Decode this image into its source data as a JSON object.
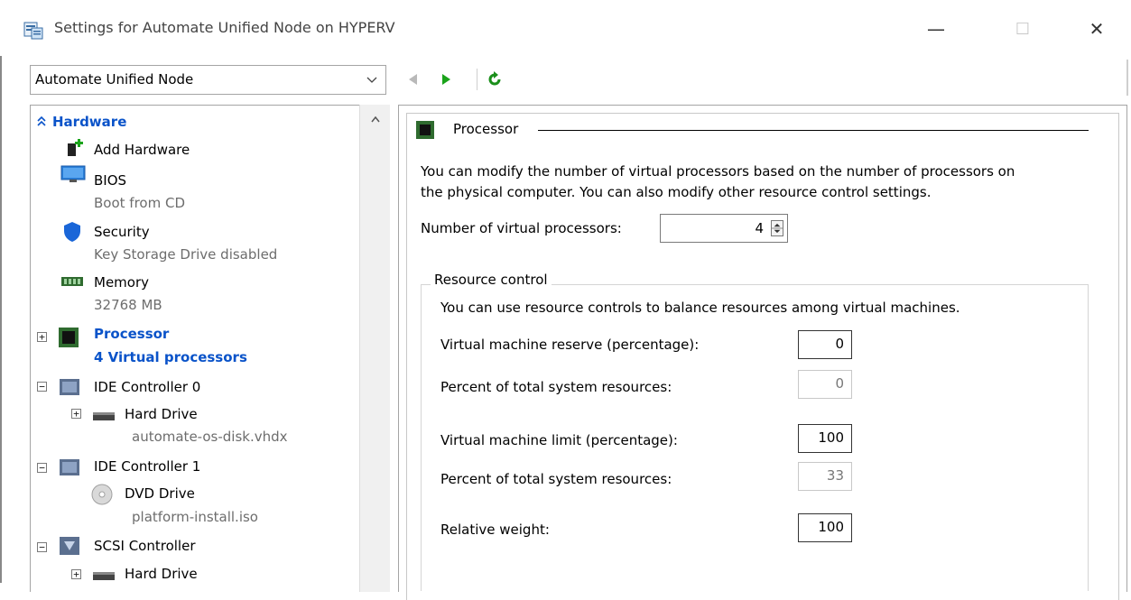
{
  "window": {
    "title": "Settings for Automate Unified Node on HYPERV",
    "minimize_glyph": "—",
    "maximize_glyph": "☐",
    "close_glyph": "✕"
  },
  "vm_select": {
    "value": "Automate Unified Node"
  },
  "tree": {
    "hardware_header": "Hardware",
    "items": [
      {
        "label": "Add Hardware",
        "sub": ""
      },
      {
        "label": "BIOS",
        "sub": "Boot from CD"
      },
      {
        "label": "Security",
        "sub": "Key Storage Drive disabled"
      },
      {
        "label": "Memory",
        "sub": "32768 MB"
      },
      {
        "label": "Processor",
        "sub": "4 Virtual processors"
      },
      {
        "label": "IDE Controller 0",
        "sub": ""
      },
      {
        "label": "Hard Drive",
        "sub": "automate-os-disk.vhdx"
      },
      {
        "label": "IDE Controller 1",
        "sub": ""
      },
      {
        "label": "DVD Drive",
        "sub": "platform-install.iso"
      },
      {
        "label": "SCSI Controller",
        "sub": ""
      },
      {
        "label": "Hard Drive",
        "sub": ""
      }
    ]
  },
  "processor": {
    "section_title": "Processor",
    "description_line1": "You can modify the number of virtual processors based on the number of processors on",
    "description_line2": "the physical computer. You can also modify other resource control settings.",
    "num_label": "Number of virtual processors:",
    "num_value": "4"
  },
  "resource_control": {
    "title": "Resource control",
    "description": "You can use resource controls to balance resources among virtual machines.",
    "reserve_label": "Virtual machine reserve (percentage):",
    "reserve_value": "0",
    "reserve_pct_label": "Percent of total system resources:",
    "reserve_pct_value": "0",
    "limit_label": "Virtual machine limit (percentage):",
    "limit_value": "100",
    "limit_pct_label": "Percent of total system resources:",
    "limit_pct_value": "33",
    "weight_label": "Relative weight:",
    "weight_value": "100"
  },
  "colors": {
    "accent_blue": "#0a53c9",
    "nav_green": "#1aa31a",
    "sub_gray": "#6d6d6d"
  }
}
